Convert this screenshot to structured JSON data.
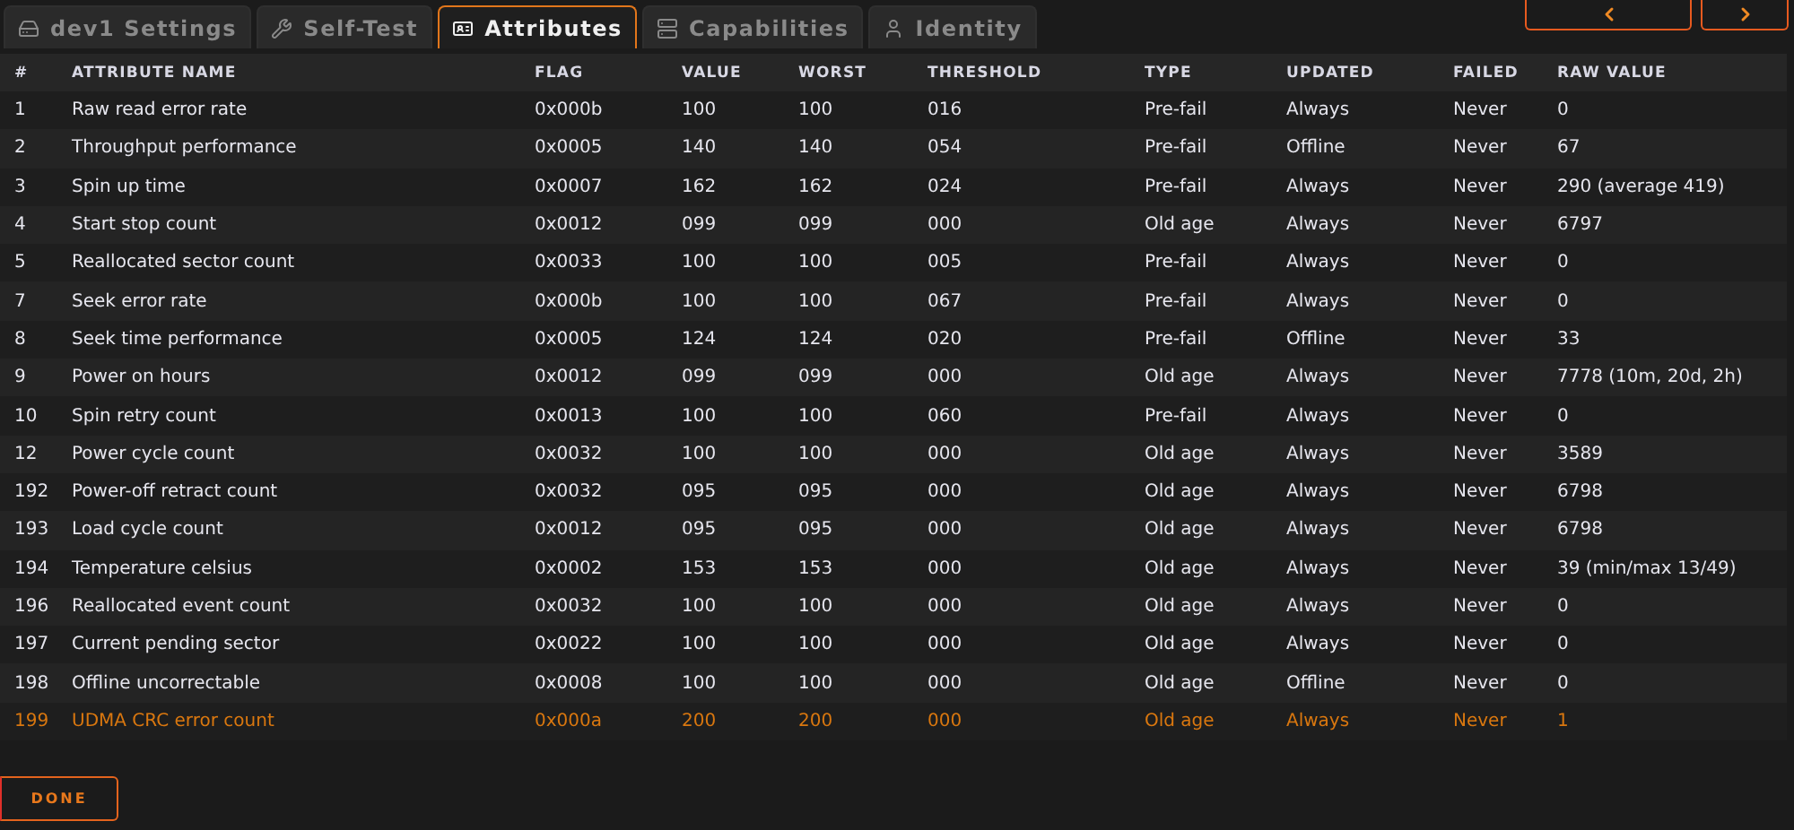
{
  "tabs": [
    {
      "label": "dev1 Settings",
      "kind": "drive",
      "selected": false
    },
    {
      "label": "Self-Test",
      "kind": "wrench",
      "selected": false
    },
    {
      "label": "Attributes",
      "kind": "card",
      "selected": true
    },
    {
      "label": "Capabilities",
      "kind": "server",
      "selected": false
    },
    {
      "label": "Identity",
      "kind": "user",
      "selected": false
    }
  ],
  "nav_buttons": [
    {
      "kind": "prev"
    },
    {
      "kind": "next"
    }
  ],
  "table": {
    "columns": [
      "#",
      "ATTRIBUTE NAME",
      "FLAG",
      "VALUE",
      "WORST",
      "THRESHOLD",
      "TYPE",
      "UPDATED",
      "FAILED",
      "RAW VALUE"
    ],
    "rows": [
      {
        "cells": [
          "1",
          "Raw read error rate",
          "0x000b",
          "100",
          "100",
          "016",
          "Pre-fail",
          "Always",
          "Never",
          "0"
        ],
        "warning": false
      },
      {
        "cells": [
          "2",
          "Throughput performance",
          "0x0005",
          "140",
          "140",
          "054",
          "Pre-fail",
          "Offline",
          "Never",
          "67"
        ],
        "warning": false
      },
      {
        "cells": [
          "3",
          "Spin up time",
          "0x0007",
          "162",
          "162",
          "024",
          "Pre-fail",
          "Always",
          "Never",
          "290 (average 419)"
        ],
        "warning": false
      },
      {
        "cells": [
          "4",
          "Start stop count",
          "0x0012",
          "099",
          "099",
          "000",
          "Old age",
          "Always",
          "Never",
          "6797"
        ],
        "warning": false
      },
      {
        "cells": [
          "5",
          "Reallocated sector count",
          "0x0033",
          "100",
          "100",
          "005",
          "Pre-fail",
          "Always",
          "Never",
          "0"
        ],
        "warning": false
      },
      {
        "cells": [
          "7",
          "Seek error rate",
          "0x000b",
          "100",
          "100",
          "067",
          "Pre-fail",
          "Always",
          "Never",
          "0"
        ],
        "warning": false
      },
      {
        "cells": [
          "8",
          "Seek time performance",
          "0x0005",
          "124",
          "124",
          "020",
          "Pre-fail",
          "Offline",
          "Never",
          "33"
        ],
        "warning": false
      },
      {
        "cells": [
          "9",
          "Power on hours",
          "0x0012",
          "099",
          "099",
          "000",
          "Old age",
          "Always",
          "Never",
          "7778 (10m, 20d, 2h)"
        ],
        "warning": false
      },
      {
        "cells": [
          "10",
          "Spin retry count",
          "0x0013",
          "100",
          "100",
          "060",
          "Pre-fail",
          "Always",
          "Never",
          "0"
        ],
        "warning": false
      },
      {
        "cells": [
          "12",
          "Power cycle count",
          "0x0032",
          "100",
          "100",
          "000",
          "Old age",
          "Always",
          "Never",
          "3589"
        ],
        "warning": false
      },
      {
        "cells": [
          "192",
          "Power-off retract count",
          "0x0032",
          "095",
          "095",
          "000",
          "Old age",
          "Always",
          "Never",
          "6798"
        ],
        "warning": false
      },
      {
        "cells": [
          "193",
          "Load cycle count",
          "0x0012",
          "095",
          "095",
          "000",
          "Old age",
          "Always",
          "Never",
          "6798"
        ],
        "warning": false
      },
      {
        "cells": [
          "194",
          "Temperature celsius",
          "0x0002",
          "153",
          "153",
          "000",
          "Old age",
          "Always",
          "Never",
          "39 (min/max 13/49)"
        ],
        "warning": false
      },
      {
        "cells": [
          "196",
          "Reallocated event count",
          "0x0032",
          "100",
          "100",
          "000",
          "Old age",
          "Always",
          "Never",
          "0"
        ],
        "warning": false
      },
      {
        "cells": [
          "197",
          "Current pending sector",
          "0x0022",
          "100",
          "100",
          "000",
          "Old age",
          "Always",
          "Never",
          "0"
        ],
        "warning": false
      },
      {
        "cells": [
          "198",
          "Offline uncorrectable",
          "0x0008",
          "100",
          "100",
          "000",
          "Old age",
          "Offline",
          "Never",
          "0"
        ],
        "warning": false
      },
      {
        "cells": [
          "199",
          "UDMA CRC error count",
          "0x000a",
          "200",
          "200",
          "000",
          "Old age",
          "Always",
          "Never",
          "1"
        ],
        "warning": true
      }
    ]
  },
  "done_button": "DONE"
}
